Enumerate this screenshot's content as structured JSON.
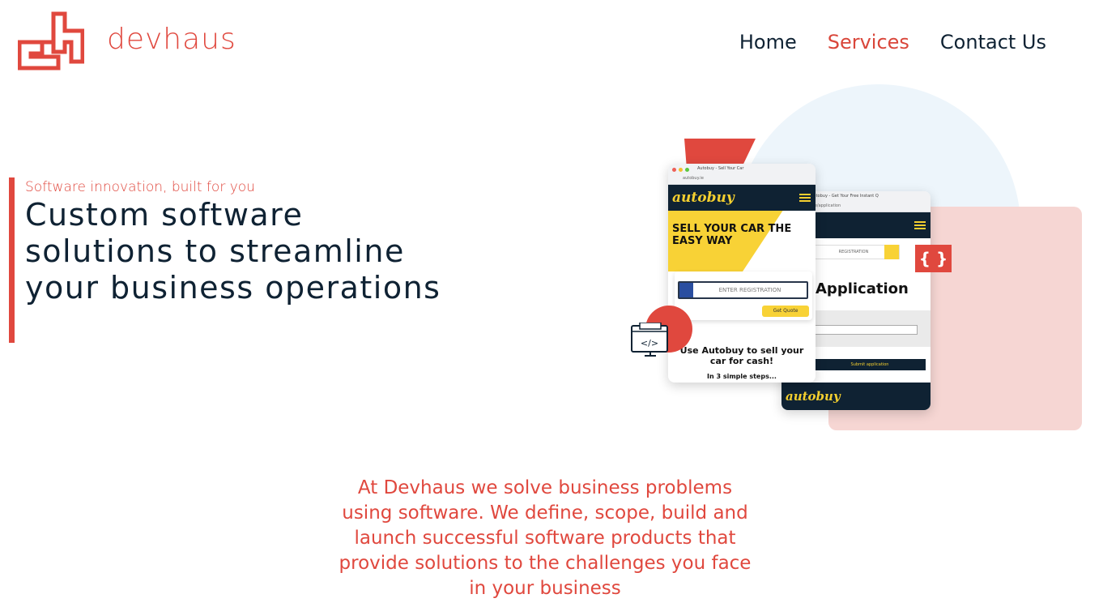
{
  "brand": {
    "name": "devhaus",
    "accent_color": "#e0483e",
    "dark_color": "#0f2233"
  },
  "nav": {
    "items": [
      {
        "label": "Home",
        "active": false
      },
      {
        "label": "Services",
        "active": true
      },
      {
        "label": "Contact Us",
        "active": false
      }
    ]
  },
  "hero": {
    "tagline": "Software innovation, built for you",
    "title": "Custom software solutions to streamline your business operations"
  },
  "illustration": {
    "front_phone": {
      "tab_title": "Autobuy - Sell Your Car",
      "url": "autobuy.ie",
      "brand": "autobuy",
      "headline": "SELL YOUR CAR THE EASY WAY",
      "registration_placeholder": "ENTER REGISTRATION",
      "quote_button": "Get Quote",
      "cta": "Use Autobuy to sell your car for cash!",
      "steps": "In 3 simple steps..."
    },
    "back_phone": {
      "tab_title": "Autobuy - Get Your Free Instant Q",
      "url": "autobuy.ie/application",
      "registration_placeholder": "REGISTRATION",
      "heading": "Application",
      "submit_label": "Submit application",
      "footer_brand": "autobuy"
    },
    "brace_badge": "{ }",
    "code_icon_label": "</>"
  },
  "intro": {
    "text": "At Devhaus we solve business problems using software. We define, scope, build and launch successful software products that provide solutions to the challenges you face in your business"
  }
}
